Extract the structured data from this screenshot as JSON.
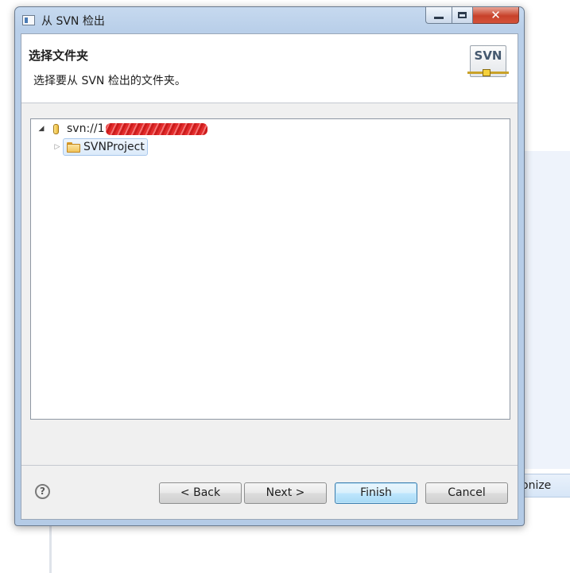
{
  "window": {
    "title": "从 SVN 检出",
    "close_glyph": "✕"
  },
  "header": {
    "title": "选择文件夹",
    "description": "选择要从 SVN 检出的文件夹。",
    "logo_text": "SVN"
  },
  "tree": {
    "items": [
      {
        "label": "svn://1",
        "expanded": true,
        "icon": "repository-icon"
      },
      {
        "label": "SVNProject",
        "expanded": false,
        "icon": "folder-icon",
        "selected": true
      }
    ]
  },
  "footer": {
    "help_glyph": "?",
    "back_label": "< Back",
    "next_label": "Next >",
    "finish_label": "Finish",
    "cancel_label": "Cancel"
  },
  "background": {
    "sync_button_partial": "onize"
  }
}
